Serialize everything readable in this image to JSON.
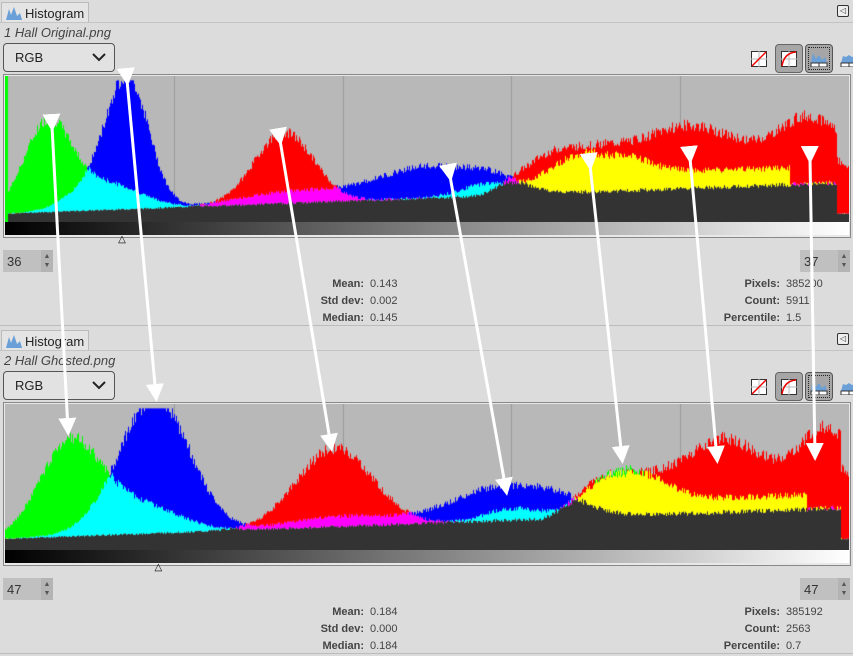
{
  "panels": [
    {
      "tab_label": "Histogram",
      "file_name": "1 Hall Original.png",
      "channel": "RGB",
      "range_start": "36",
      "range_end": "37",
      "stats_left": [
        {
          "k": "Mean:",
          "v": "0.143"
        },
        {
          "k": "Std dev:",
          "v": "0.002"
        },
        {
          "k": "Median:",
          "v": "0.145"
        }
      ],
      "stats_right": [
        {
          "k": "Pixels:",
          "v": "385200"
        },
        {
          "k": "Count:",
          "v": "5911"
        },
        {
          "k": "Percentile:",
          "v": "1.5"
        }
      ],
      "marker": "△",
      "marker_value": 36
    },
    {
      "tab_label": "Histogram",
      "file_name": "2 Hall Ghosted.png",
      "channel": "RGB",
      "range_start": "47",
      "range_end": "47",
      "stats_left": [
        {
          "k": "Mean:",
          "v": "0.184"
        },
        {
          "k": "Std dev:",
          "v": "0.000"
        },
        {
          "k": "Median:",
          "v": "0.184"
        }
      ],
      "stats_right": [
        {
          "k": "Pixels:",
          "v": "385192"
        },
        {
          "k": "Count:",
          "v": "2563"
        },
        {
          "k": "Percentile:",
          "v": "0.7"
        }
      ],
      "marker": "△",
      "marker_value": 47
    }
  ],
  "icons": [
    "linear-scale-icon",
    "logarithmic-scale-icon",
    "linear-histogram-icon",
    "logarithmic-histogram-icon"
  ],
  "colors": {
    "red": "#ff0000",
    "green": "#00ff00",
    "blue": "#0000ff",
    "cyan": "#00ffff",
    "magenta": "#ff00ff",
    "yellow": "#ffff00",
    "gray": "#333333",
    "bg": "#b8b8b8"
  }
}
